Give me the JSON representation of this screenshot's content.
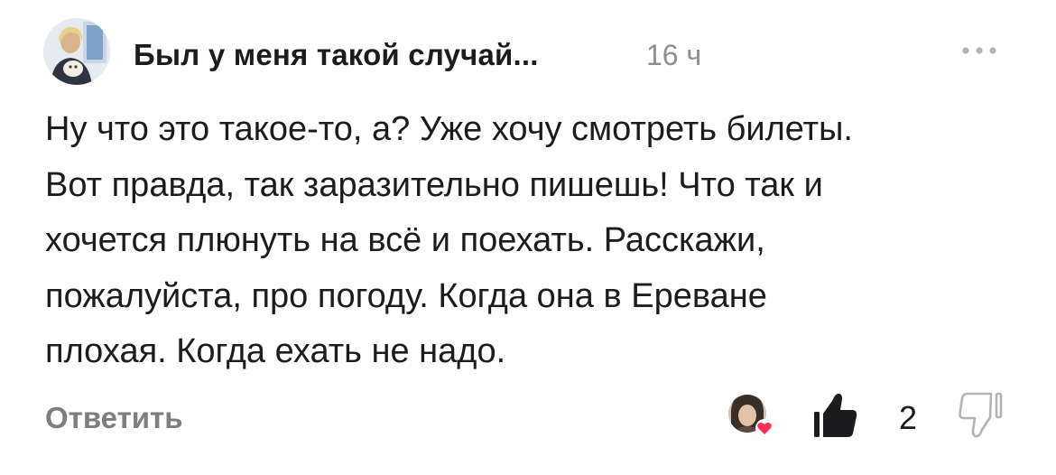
{
  "comment": {
    "author": "Был у меня такой случай...",
    "time": "16 ч",
    "text_lines": [
      "Ну что это такое-то, а? Уже хочу смотреть билеты.",
      "Вот правда, так заразительно пишешь! Что так и",
      "хочется плюнуть на всё и поехать. Расскажи,",
      "пожалуйста, про погоду. Когда она в Ереване",
      "плохая. Когда ехать не надо."
    ],
    "reply_label": "Ответить",
    "like_count": "2",
    "icons": {
      "more": "more-dots-icon",
      "like": "thumbs-up-icon",
      "dislike": "thumbs-down-icon",
      "reaction": "heart-icon"
    }
  },
  "colors": {
    "text": "#1c1c1e",
    "muted": "#8e8e93",
    "reply": "#7d7d82",
    "heart": "#ff2d55"
  }
}
